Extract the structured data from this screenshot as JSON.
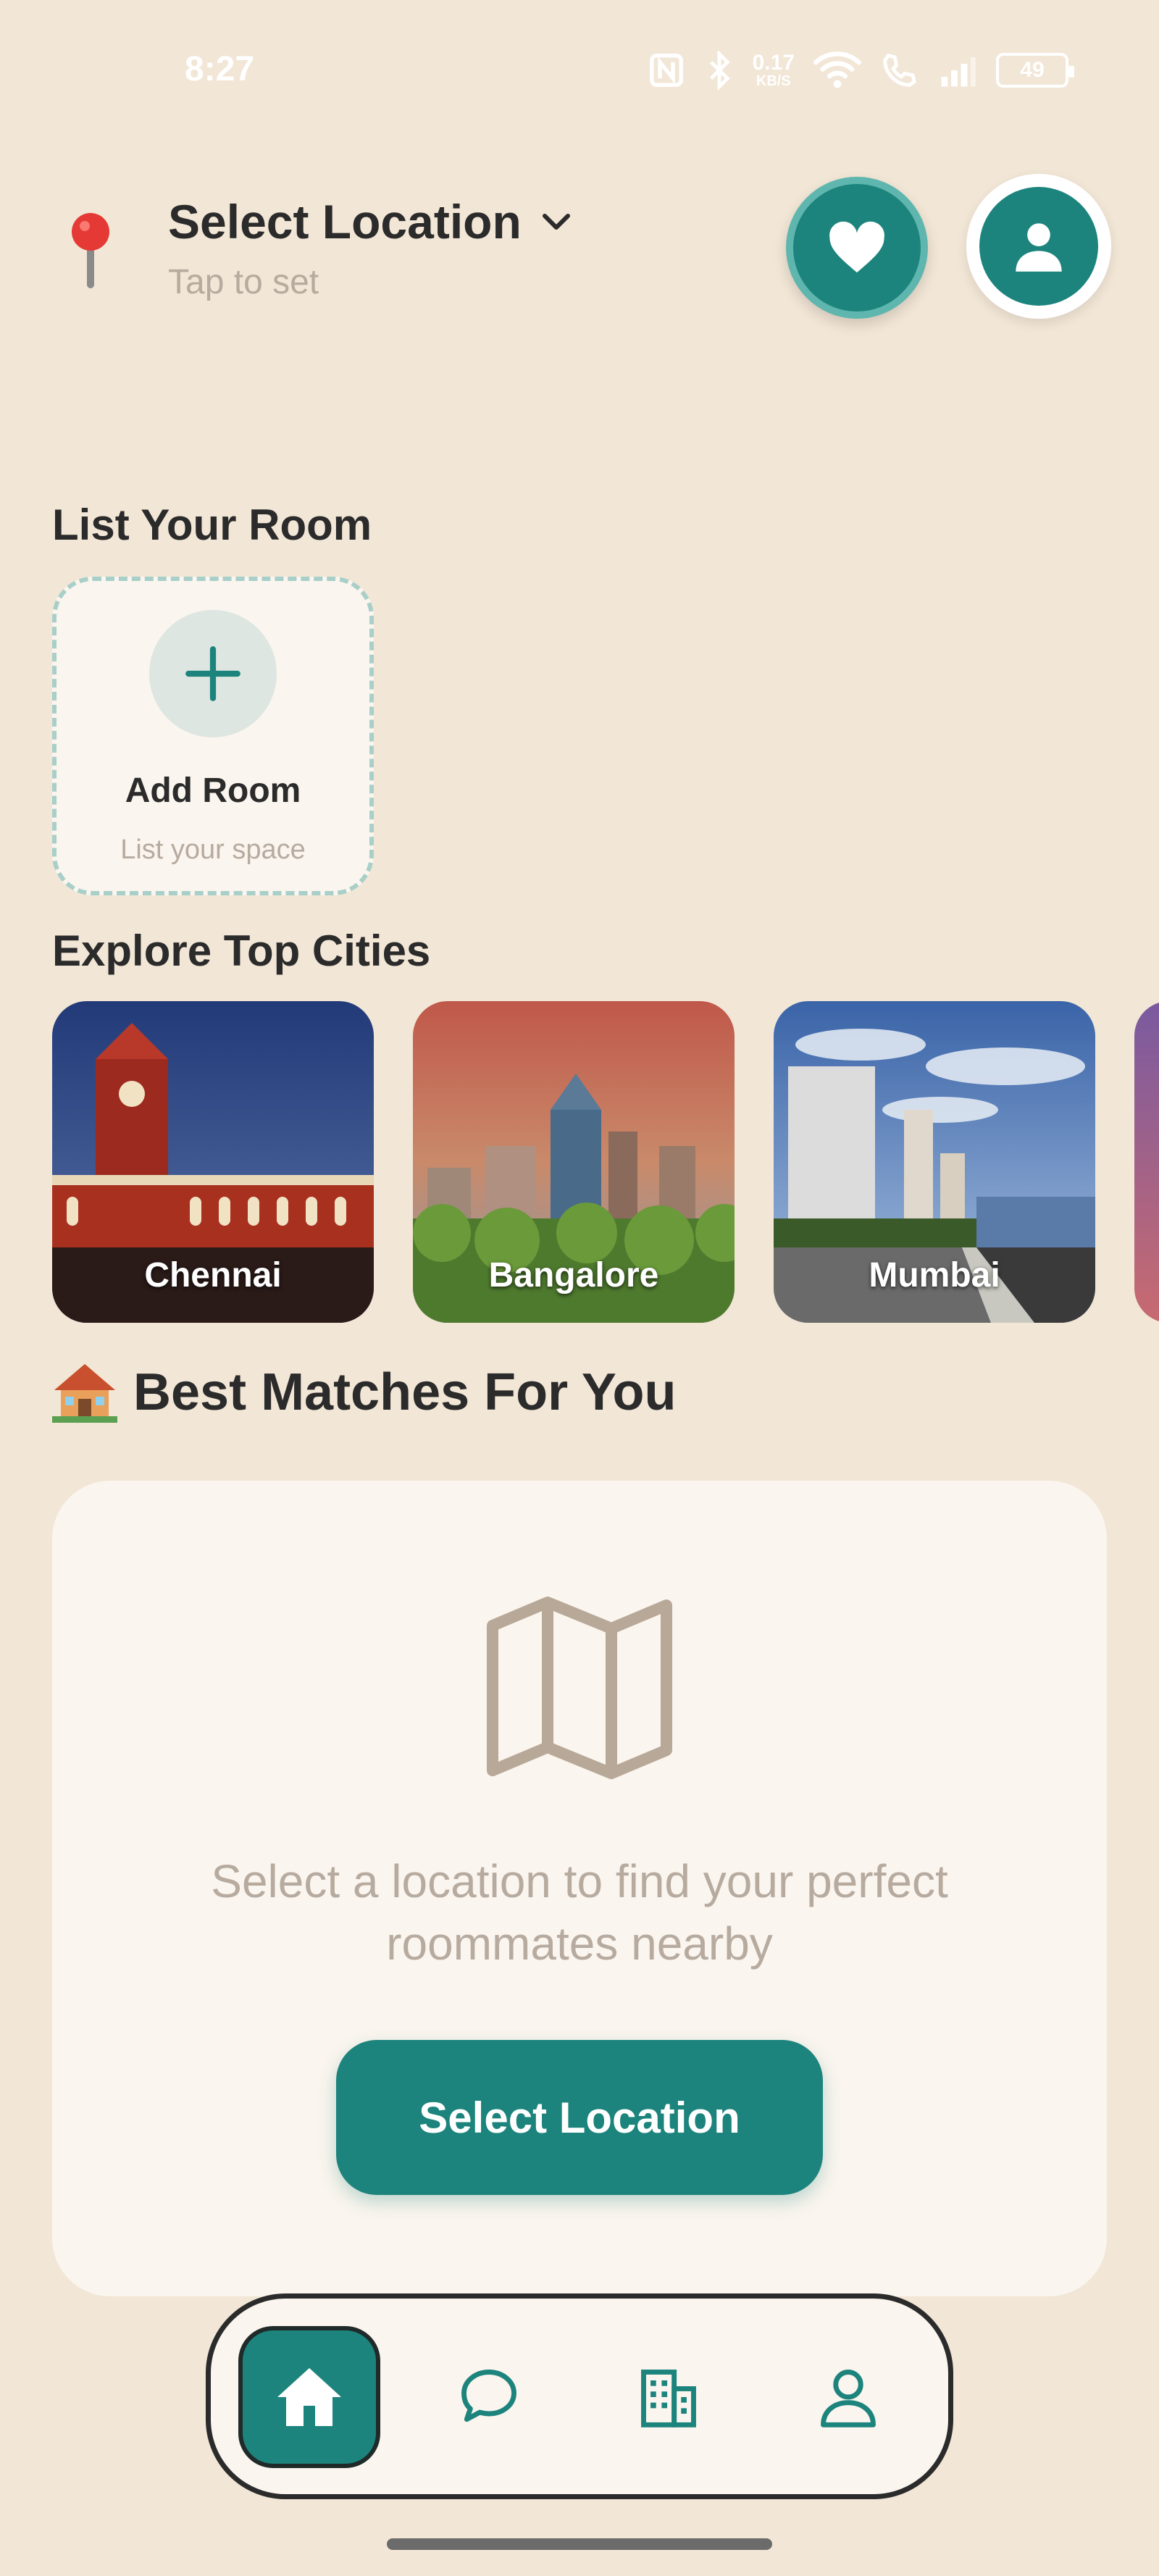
{
  "status_bar": {
    "time": "8:27",
    "net_speed_value": "0.17",
    "net_speed_unit": "KB/S",
    "battery": "49",
    "icons": [
      "nfc-icon",
      "bluetooth-icon",
      "wifi-icon",
      "call-icon",
      "signal-icon",
      "battery-icon"
    ]
  },
  "header": {
    "location_title": "Select Location",
    "location_subtitle": "Tap to set",
    "icons": {
      "location": "location-pin-icon",
      "dropdown": "chevron-down-icon",
      "favorites": "heart-icon",
      "profile": "user-icon"
    }
  },
  "list_room": {
    "section_title": "List Your Room",
    "card_label": "Add Room",
    "card_sublabel": "List your space"
  },
  "cities": {
    "section_title": "Explore Top Cities",
    "items": [
      {
        "name": "Chennai"
      },
      {
        "name": "Bangalore"
      },
      {
        "name": "Mumbai"
      },
      {
        "name": ""
      }
    ]
  },
  "matches": {
    "section_title": "Best Matches For You",
    "empty_message": "Select a location to find your perfect roommates nearby",
    "cta_label": "Select Location",
    "icons": {
      "title": "house-icon",
      "empty": "map-icon"
    }
  },
  "bottom_nav": {
    "items": [
      {
        "icon": "home-icon",
        "active": true
      },
      {
        "icon": "chat-icon",
        "active": false
      },
      {
        "icon": "building-icon",
        "active": false
      },
      {
        "icon": "person-icon",
        "active": false
      }
    ]
  },
  "colors": {
    "background": "#f2e6d6",
    "accent": "#1c847d",
    "card": "#faf5ee",
    "muted_text": "#b7aba0"
  }
}
